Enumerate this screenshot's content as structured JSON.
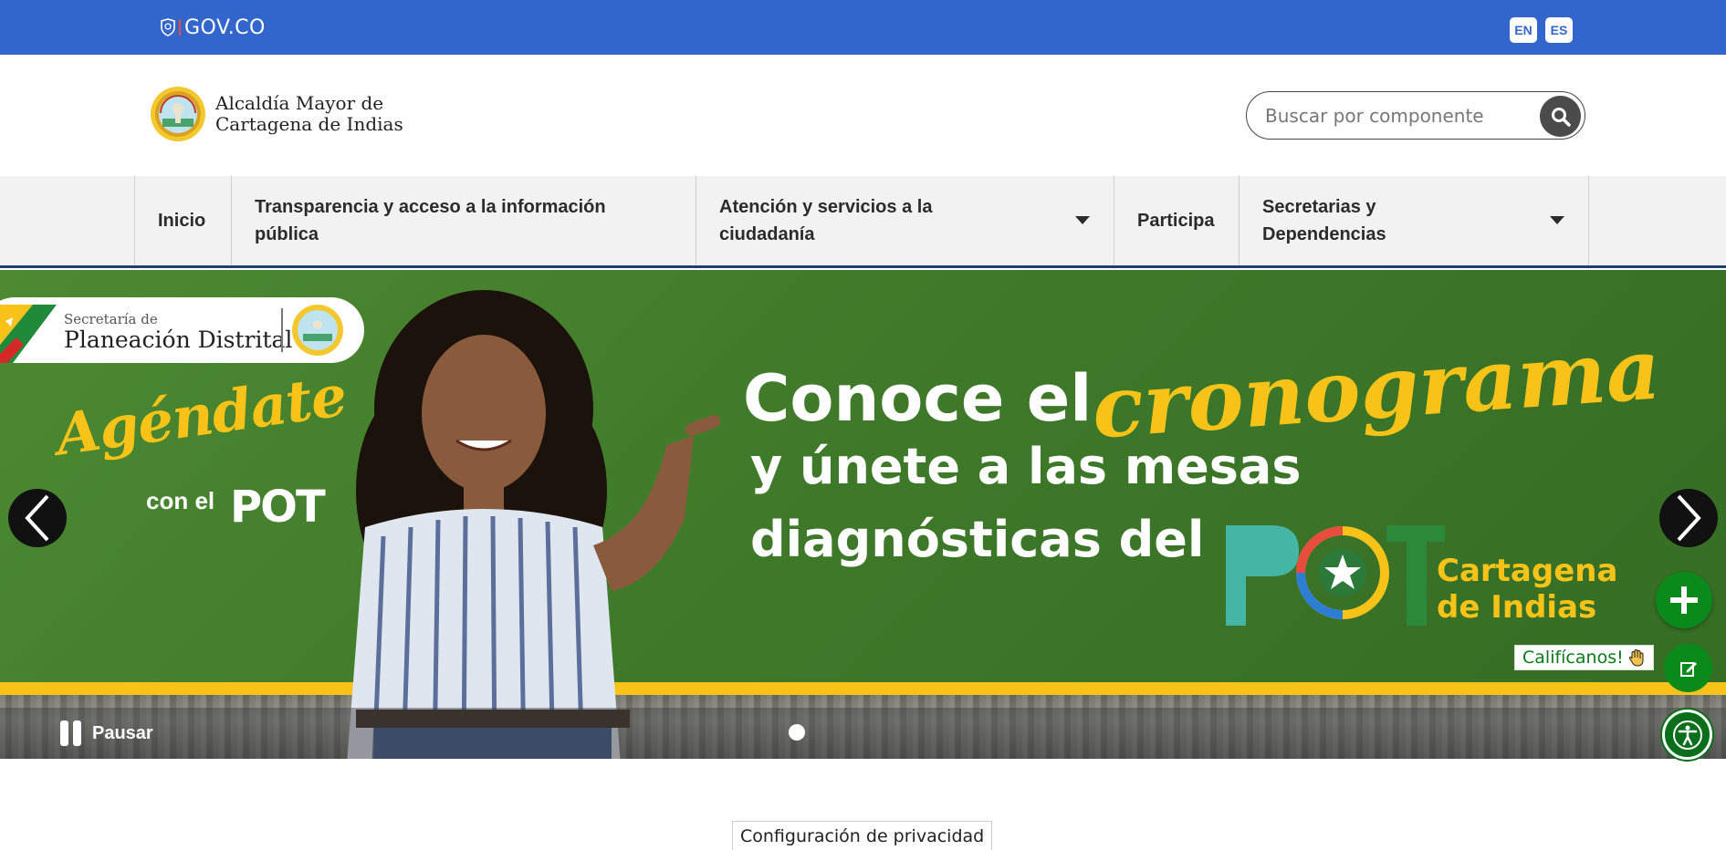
{
  "govbar": {
    "logo_text": "GOV.CO",
    "lang_en": "EN",
    "lang_es": "ES",
    "bg_color": "#3366cc"
  },
  "header": {
    "brand_line1": "Alcaldía Mayor de",
    "brand_line2": "Cartagena de Indias",
    "search_placeholder": "Buscar por componente",
    "search_icon": "search-icon"
  },
  "nav": {
    "items": [
      {
        "label": "Inicio",
        "dropdown": false
      },
      {
        "label": "Transparencia y acceso a la información pública",
        "dropdown": false
      },
      {
        "label": "Atención y servicios a la ciudadanía",
        "dropdown": true
      },
      {
        "label": "Participa",
        "dropdown": false
      },
      {
        "label": "Secretarias y Dependencias",
        "dropdown": true
      }
    ],
    "accent_color": "#1f3e78"
  },
  "banner": {
    "pill_sub": "Secretaría de",
    "pill_main": "Planeación Distrital",
    "agendate": "Agéndate",
    "con_el": "con el",
    "pot_small": "POT",
    "headline_1": "Conoce el",
    "headline_cronograma": "cronograma",
    "headline_2": "y únete a las mesas",
    "headline_3": "diagnósticas del",
    "pot_big": "POT",
    "cartagena_line1": "Cartagena",
    "cartagena_line2": "de Indias",
    "pause_label": "Pausar",
    "accent_yellow": "#f7c318",
    "bg_green": "#3f7a2a",
    "slide_count": 1
  },
  "widgets": {
    "rate_label": "Califícanos!",
    "plus_icon": "plus-icon",
    "rate_icon": "edit-icon",
    "access_icon": "accessibility-icon",
    "color": "#0a8a1a"
  },
  "footer": {
    "privacy_label": "Configuración de privacidad"
  }
}
